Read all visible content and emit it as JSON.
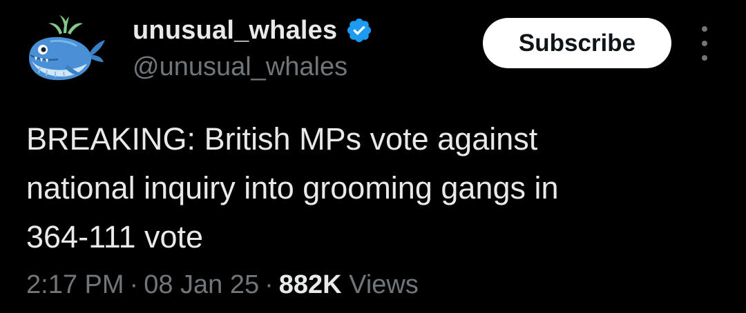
{
  "author": {
    "display_name": "unusual_whales",
    "handle": "@unusual_whales",
    "verified": true,
    "avatar_icon": "whale-avatar-icon"
  },
  "actions": {
    "subscribe_label": "Subscribe",
    "more_icon": "more-vertical-icon"
  },
  "tweet": {
    "text": "BREAKING: British MPs vote against\nnational inquiry into grooming gangs in\n364-111 vote"
  },
  "meta": {
    "time": "2:17 PM",
    "separator": "·",
    "date": "08 Jan 25",
    "views_count": "882K",
    "views_label": "Views"
  },
  "colors": {
    "background": "#000000",
    "primary_text": "#e7e9ea",
    "secondary_text": "#71767b",
    "verified_blue": "#1d9bf0",
    "button_bg": "#ffffff",
    "button_text": "#0f1419"
  }
}
